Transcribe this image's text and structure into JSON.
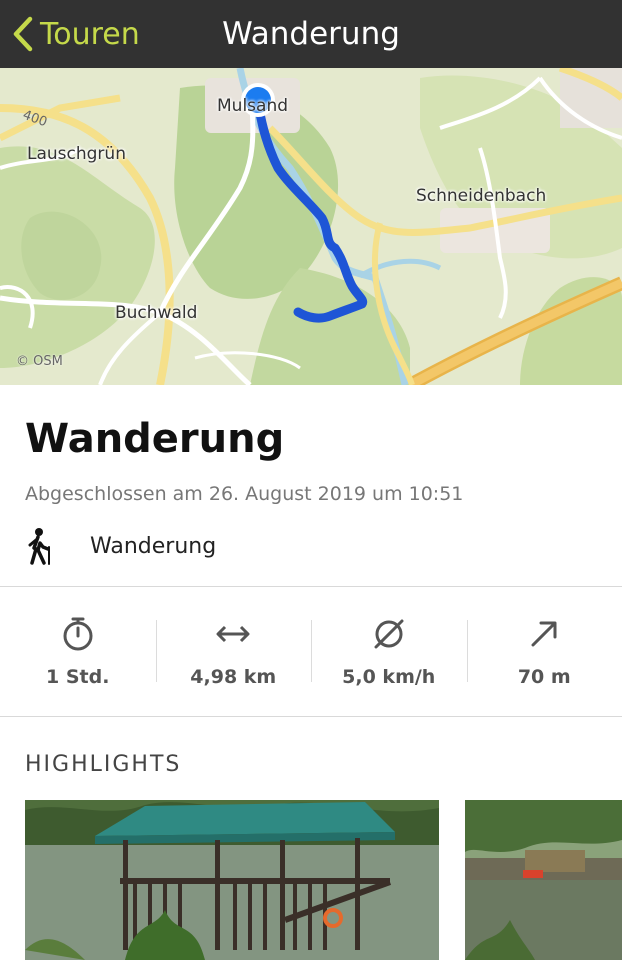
{
  "header": {
    "back_label": "Touren",
    "title": "Wanderung"
  },
  "map": {
    "places": {
      "start": "Mulsand",
      "lauschgruen": "Lauschgrün",
      "schneidenbach": "Schneidenbach",
      "buchwald": "Buchwald"
    },
    "road_number": "400",
    "attribution": "© OSM",
    "route_color": "#1e55d6"
  },
  "tour": {
    "name": "Wanderung",
    "completed": "Abgeschlossen am 26. August 2019 um 10:51",
    "sport_icon": "hiker-icon",
    "sport": "Wanderung"
  },
  "stats": [
    {
      "icon": "stopwatch-icon",
      "value": "1 Std."
    },
    {
      "icon": "distance-arrows-icon",
      "value": "4,98 km"
    },
    {
      "icon": "average-speed-icon",
      "value": "5,0 km/h"
    },
    {
      "icon": "uphill-arrow-icon",
      "value": "70 m"
    }
  ],
  "highlights": {
    "heading": "HIGHLIGHTS"
  },
  "colors": {
    "accent": "#c5d94a",
    "topbar": "#323232"
  }
}
